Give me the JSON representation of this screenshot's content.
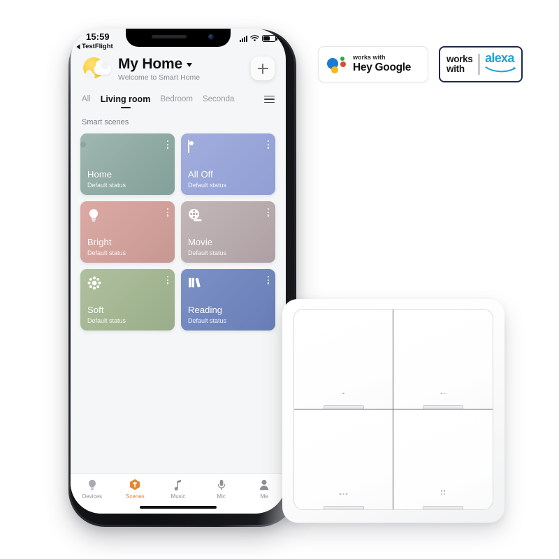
{
  "phone": {
    "status_bar": {
      "time": "15:59",
      "back_label": "TestFlight",
      "signal_icon": "cellular-signal-icon",
      "wifi_icon": "wifi-icon",
      "battery_icon": "battery-icon"
    },
    "header": {
      "weather_icon": "sun-behind-cloud-icon",
      "title": "My Home",
      "dropdown_icon": "chevron-down-icon",
      "subtitle": "Welcome to Smart Home",
      "add_button_icon": "plus-icon"
    },
    "room_tabs": {
      "items": [
        {
          "label": "All",
          "active": false
        },
        {
          "label": "Living room",
          "active": true
        },
        {
          "label": "Bedroom",
          "active": false
        },
        {
          "label": "Seconda",
          "active": false
        }
      ],
      "menu_icon": "hamburger-menu-icon"
    },
    "section_label": "Smart scenes",
    "scenes": [
      {
        "name": "Home",
        "status": "Default status",
        "icon": "toggle-on-icon",
        "color": "#93b0a9"
      },
      {
        "name": "All Off",
        "status": "Default status",
        "icon": "toggle-off-icon",
        "color": "#97a3d7"
      },
      {
        "name": "Bright",
        "status": "Default status",
        "icon": "lightbulb-icon",
        "color": "#d2a09b"
      },
      {
        "name": "Movie",
        "status": "Default status",
        "icon": "film-reel-icon",
        "color": "#b8abad"
      },
      {
        "name": "Soft",
        "status": "Default status",
        "icon": "brightness-icon",
        "color": "#a3b692"
      },
      {
        "name": "Reading",
        "status": "Default status",
        "icon": "books-icon",
        "color": "#7086bd"
      }
    ],
    "bottom_nav": {
      "items": [
        {
          "label": "Devices",
          "icon": "bulb-icon",
          "active": false
        },
        {
          "label": "Scenes",
          "icon": "scenes-cube-icon",
          "active": true
        },
        {
          "label": "Music",
          "icon": "music-note-icon",
          "active": false
        },
        {
          "label": "Mic",
          "icon": "microphone-icon",
          "active": false
        },
        {
          "label": "Me",
          "icon": "person-icon",
          "active": false
        }
      ],
      "active_color": "#e2862f"
    },
    "home_indicator": "home-indicator"
  },
  "badges": {
    "google": {
      "logo_icon": "google-assistant-icon",
      "small_text": "works with",
      "big_text": "Hey Google"
    },
    "alexa": {
      "line1": "works",
      "line2": "with",
      "wordmark": "alexa",
      "swoosh_icon": "amazon-smile-icon",
      "border_color": "#1f2a48",
      "wordmark_color": "#23a2d4"
    }
  },
  "switch_panel": {
    "name": "4-gang-wireless-scene-switch",
    "buttons": [
      {
        "position": "top-left",
        "dots": 1
      },
      {
        "position": "top-right",
        "dots": 2
      },
      {
        "position": "bottom-left",
        "dots": 3
      },
      {
        "position": "bottom-right",
        "dots": 4
      }
    ]
  }
}
